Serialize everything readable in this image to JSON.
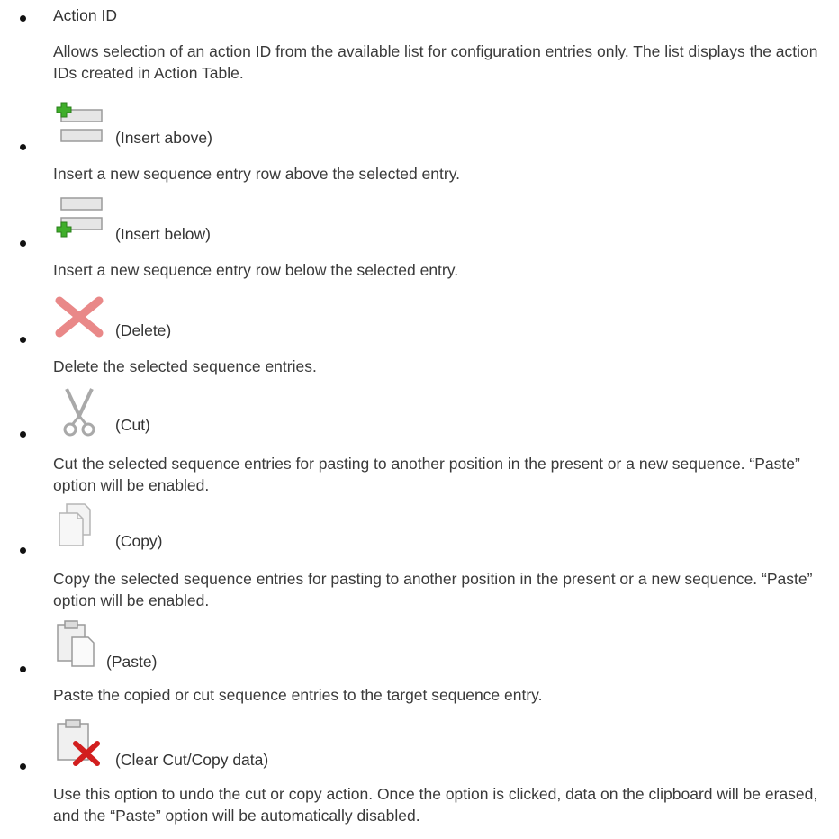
{
  "items": [
    {
      "label": "Action ID",
      "description": "Allows selection of an action ID from the available list for configuration entries only. The list displays the action IDs created in Action Table."
    },
    {
      "icon": "insert-above-icon",
      "label": "(Insert above)",
      "description": "Insert a new sequence entry row above the selected entry."
    },
    {
      "icon": "insert-below-icon",
      "label": "(Insert below)",
      "description": "Insert a new sequence entry row below the selected entry."
    },
    {
      "icon": "delete-icon",
      "label": "(Delete)",
      "description": "Delete the selected sequence entries."
    },
    {
      "icon": "cut-icon",
      "label": "(Cut)",
      "description": "Cut the selected sequence entries for pasting to another position in the present or a new sequence. “Paste” option will be enabled."
    },
    {
      "icon": "copy-icon",
      "label": "(Copy)",
      "description": "Copy the selected sequence entries for pasting to another position in the present or a new sequence. “Paste” option will be enabled."
    },
    {
      "icon": "paste-icon",
      "label": "(Paste)",
      "description": "Paste the copied or cut sequence entries to the target sequence entry."
    },
    {
      "icon": "clear-cut-copy-icon",
      "label": "(Clear Cut/Copy data)",
      "description": "Use this option to undo the cut or copy action. Once the option is clicked, data on the clipboard will be erased, and the “Paste” option will be automatically disabled."
    }
  ]
}
